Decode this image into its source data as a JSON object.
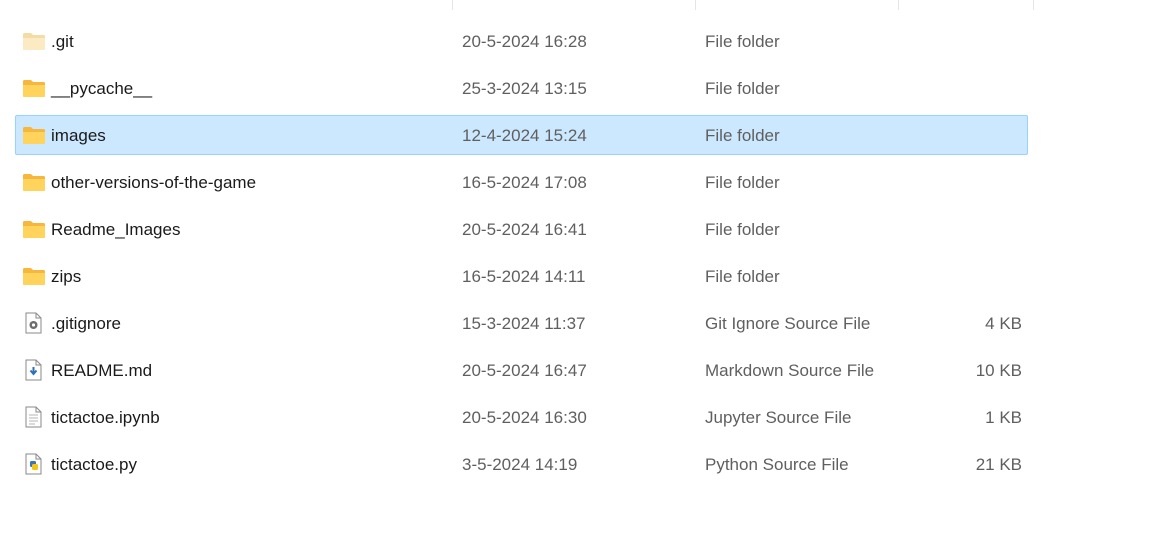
{
  "files": [
    {
      "name": ".git",
      "date": "20-5-2024 16:28",
      "type": "File folder",
      "size": "",
      "icon": "folder-icon-faded"
    },
    {
      "name": "__pycache__",
      "date": "25-3-2024 13:15",
      "type": "File folder",
      "size": "",
      "icon": "folder-icon"
    },
    {
      "name": "images",
      "date": "12-4-2024 15:24",
      "type": "File folder",
      "size": "",
      "icon": "folder-icon",
      "selected": true
    },
    {
      "name": "other-versions-of-the-game",
      "date": "16-5-2024 17:08",
      "type": "File folder",
      "size": "",
      "icon": "folder-icon"
    },
    {
      "name": "Readme_Images",
      "date": "20-5-2024 16:41",
      "type": "File folder",
      "size": "",
      "icon": "folder-icon"
    },
    {
      "name": "zips",
      "date": "16-5-2024 14:11",
      "type": "File folder",
      "size": "",
      "icon": "folder-icon"
    },
    {
      "name": ".gitignore",
      "date": "15-3-2024 11:37",
      "type": "Git Ignore Source File",
      "size": "4 KB",
      "icon": "settings-file-icon"
    },
    {
      "name": "README.md",
      "date": "20-5-2024 16:47",
      "type": "Markdown Source File",
      "size": "10 KB",
      "icon": "markdown-file-icon"
    },
    {
      "name": "tictactoe.ipynb",
      "date": "20-5-2024 16:30",
      "type": "Jupyter Source File",
      "size": "1 KB",
      "icon": "text-file-icon"
    },
    {
      "name": "tictactoe.py",
      "date": "3-5-2024 14:19",
      "type": "Python Source File",
      "size": "21 KB",
      "icon": "python-file-icon"
    }
  ],
  "colors": {
    "selection_bg": "#cce8ff",
    "selection_border": "#99d1ff",
    "folder": "#ffc83d",
    "secondary_text": "#5f5f5f"
  }
}
